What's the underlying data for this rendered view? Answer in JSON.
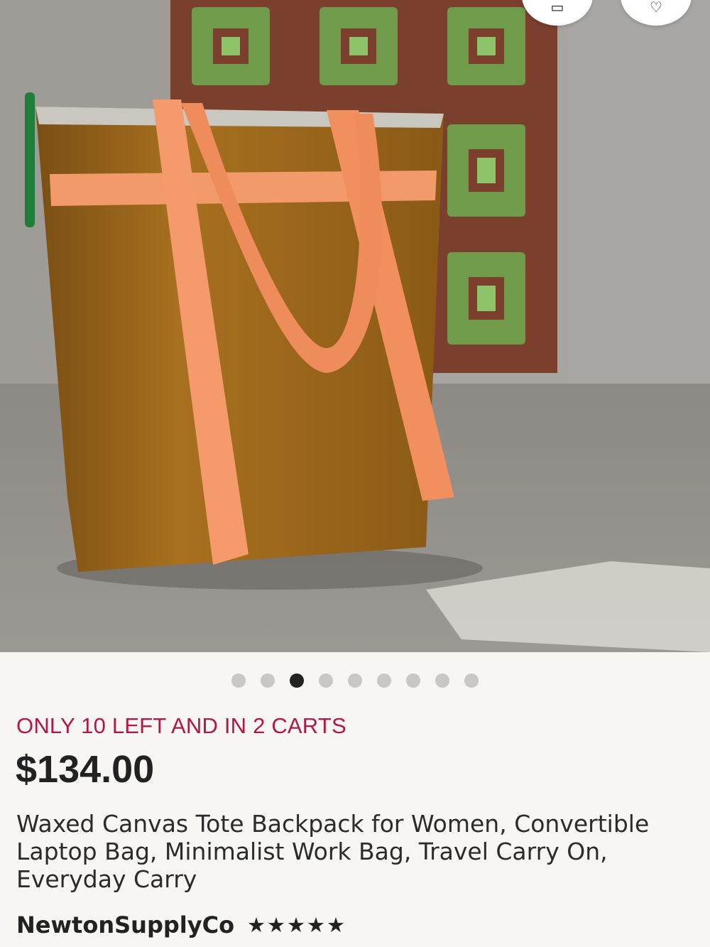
{
  "listing": {
    "image": {
      "alt": "Mustard waxed canvas tote backpack with peach straps on a concrete floor",
      "carousel_count": 9,
      "carousel_active_index": 2
    },
    "stock_notice": "ONLY 10 LEFT AND IN 2 CARTS",
    "price": "$134.00",
    "title": "Waxed Canvas Tote Backpack for Women, Convertible Laptop Bag, Minimalist Work Bag, Travel Carry On, Everyday Carry",
    "shop_name": "NewtonSupplyCo",
    "rating": {
      "stars": "★★★★★",
      "value": 5,
      "max": 5
    }
  },
  "top_buttons": [
    {
      "icon": "share-icon",
      "glyph": "▭"
    },
    {
      "icon": "favorite-heart-icon",
      "glyph": "♡"
    }
  ],
  "colors": {
    "stock_notice": "#b3174a",
    "dot_active": "#222222",
    "dot_inactive": "#c9c7c3",
    "background": "#f7f6f3"
  }
}
